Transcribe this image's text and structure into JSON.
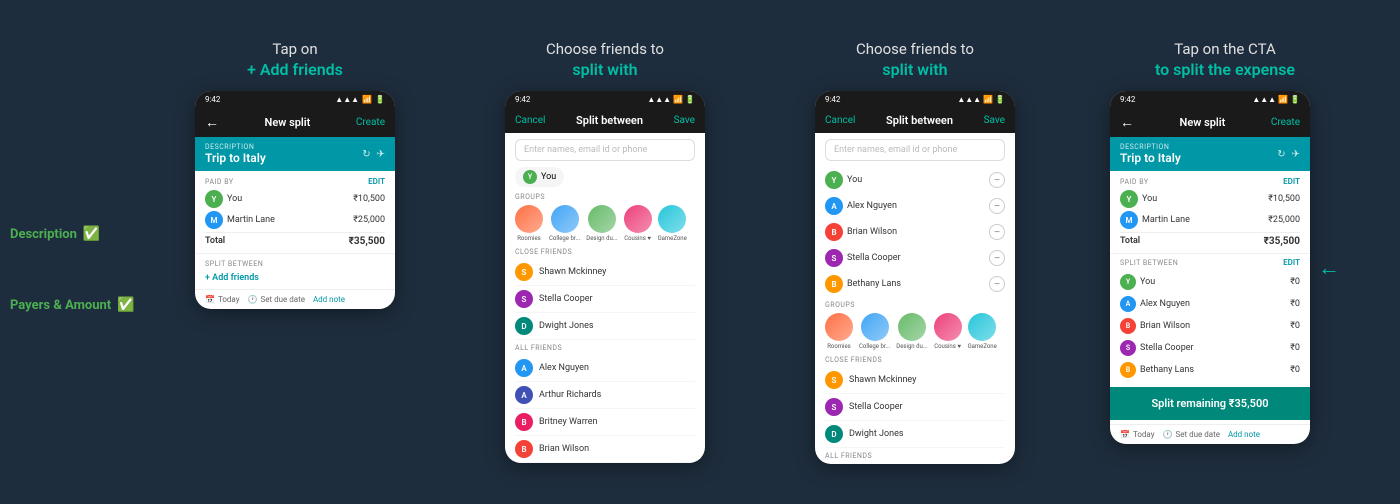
{
  "steps": [
    {
      "id": "step1",
      "label_top": "Tap on",
      "label_bottom": "+ Add friends"
    },
    {
      "id": "step2",
      "label_top": "Choose friends to",
      "label_bottom": "split with"
    },
    {
      "id": "step3",
      "label_top": "Choose friends to",
      "label_bottom": "split with"
    },
    {
      "id": "step4",
      "label_top": "Tap on the CTA",
      "label_bottom": "to split the expense"
    }
  ],
  "side_labels": {
    "description": "Description",
    "payers": "Payers & Amount"
  },
  "phone1": {
    "status": "9:42",
    "header_title": "New split",
    "header_action": "Create",
    "description_label": "DESCRIPTION",
    "description_value": "Trip to Italy",
    "paid_by_label": "PAID BY",
    "edit": "EDIT",
    "payers": [
      {
        "name": "You",
        "amount": "₹10,500",
        "avatar_color": "green",
        "initial": "Y"
      },
      {
        "name": "Martin Lane",
        "amount": "₹25,000",
        "avatar_color": "blue",
        "initial": "M"
      }
    ],
    "total_label": "Total",
    "total_amount": "₹35,500",
    "split_between_label": "SPLIT BETWEEN",
    "add_friends": "+ Add friends",
    "date_label": "Today",
    "due_date_label": "Set due date",
    "add_note": "Add note"
  },
  "phone2": {
    "status": "9:42",
    "cancel": "Cancel",
    "header_title": "Split between",
    "save": "Save",
    "search_placeholder": "Enter names, email id or phone",
    "you_label": "You",
    "groups_label": "GROUPS",
    "groups": [
      {
        "name": "Roomies",
        "class": "ga1"
      },
      {
        "name": "College br...",
        "class": "ga2"
      },
      {
        "name": "Design du...",
        "class": "ga3"
      },
      {
        "name": "Cousins ♥",
        "class": "ga4"
      },
      {
        "name": "GameZone",
        "class": "ga5"
      }
    ],
    "close_friends_label": "CLOSE FRIENDS",
    "close_friends": [
      {
        "name": "Shawn Mckinney",
        "initial": "S",
        "color": "orange"
      },
      {
        "name": "Stella Cooper",
        "initial": "S",
        "color": "purple"
      },
      {
        "name": "Dwight Jones",
        "initial": "D",
        "color": "teal"
      }
    ],
    "all_friends_label": "ALL FRIENDS",
    "all_friends": [
      {
        "name": "Alex Nguyen",
        "initial": "A",
        "color": "blue"
      },
      {
        "name": "Arthur Richards",
        "initial": "A",
        "color": "indigo"
      },
      {
        "name": "Britney Warren",
        "initial": "B",
        "color": "pink"
      },
      {
        "name": "Brian Wilson",
        "initial": "B",
        "color": "red"
      }
    ]
  },
  "phone3": {
    "status": "9:42",
    "cancel": "Cancel",
    "header_title": "Split between",
    "save": "Save",
    "search_placeholder": "Enter names, email id or phone",
    "selected": [
      {
        "name": "You",
        "initial": "Y",
        "color": "green"
      },
      {
        "name": "Alex Nguyen",
        "initial": "A",
        "color": "blue"
      },
      {
        "name": "Brian Wilson",
        "initial": "B",
        "color": "red"
      },
      {
        "name": "Stella Cooper",
        "initial": "S",
        "color": "purple"
      },
      {
        "name": "Bethany Lans",
        "initial": "B",
        "color": "orange"
      }
    ],
    "groups_label": "GROUPS",
    "groups": [
      {
        "name": "Roomies",
        "class": "ga1"
      },
      {
        "name": "College br...",
        "class": "ga2"
      },
      {
        "name": "Design du...",
        "class": "ga3"
      },
      {
        "name": "Cousins ♥",
        "class": "ga4"
      },
      {
        "name": "GameZone",
        "class": "ga5"
      }
    ],
    "close_friends_label": "CLOSE FRIENDS",
    "close_friends": [
      {
        "name": "Shawn Mckinney",
        "initial": "S",
        "color": "orange"
      },
      {
        "name": "Stella Cooper",
        "initial": "S",
        "color": "purple"
      },
      {
        "name": "Dwight Jones",
        "initial": "D",
        "color": "teal"
      }
    ],
    "all_friends_label": "ALL FRIENDS"
  },
  "phone4": {
    "status": "9:42",
    "header_title": "New split",
    "header_action": "Create",
    "description_label": "DESCRIPTION",
    "description_value": "Trip to Italy",
    "paid_by_label": "PAID BY",
    "edit": "EDIT",
    "payers": [
      {
        "name": "You",
        "amount": "₹10,500",
        "color": "green",
        "initial": "Y"
      },
      {
        "name": "Martin Lane",
        "amount": "₹25,000",
        "color": "blue",
        "initial": "M"
      }
    ],
    "total_label": "Total",
    "total_amount": "₹35,500",
    "split_between_label": "SPLIT BETWEEN",
    "edit2": "EDIT",
    "split_members": [
      {
        "name": "You",
        "amount": "₹0",
        "initial": "Y",
        "color": "green"
      },
      {
        "name": "Alex Nguyen",
        "amount": "₹0",
        "initial": "A",
        "color": "blue"
      },
      {
        "name": "Brian Wilson",
        "amount": "₹0",
        "initial": "B",
        "color": "red"
      },
      {
        "name": "Stella Cooper",
        "amount": "₹0",
        "initial": "S",
        "color": "purple"
      },
      {
        "name": "Bethany Lans",
        "amount": "₹0",
        "initial": "B",
        "color": "orange"
      }
    ],
    "cta_label": "Split remaining ₹35,500",
    "date_label": "Today",
    "due_date_label": "Set due date",
    "add_note": "Add note"
  }
}
